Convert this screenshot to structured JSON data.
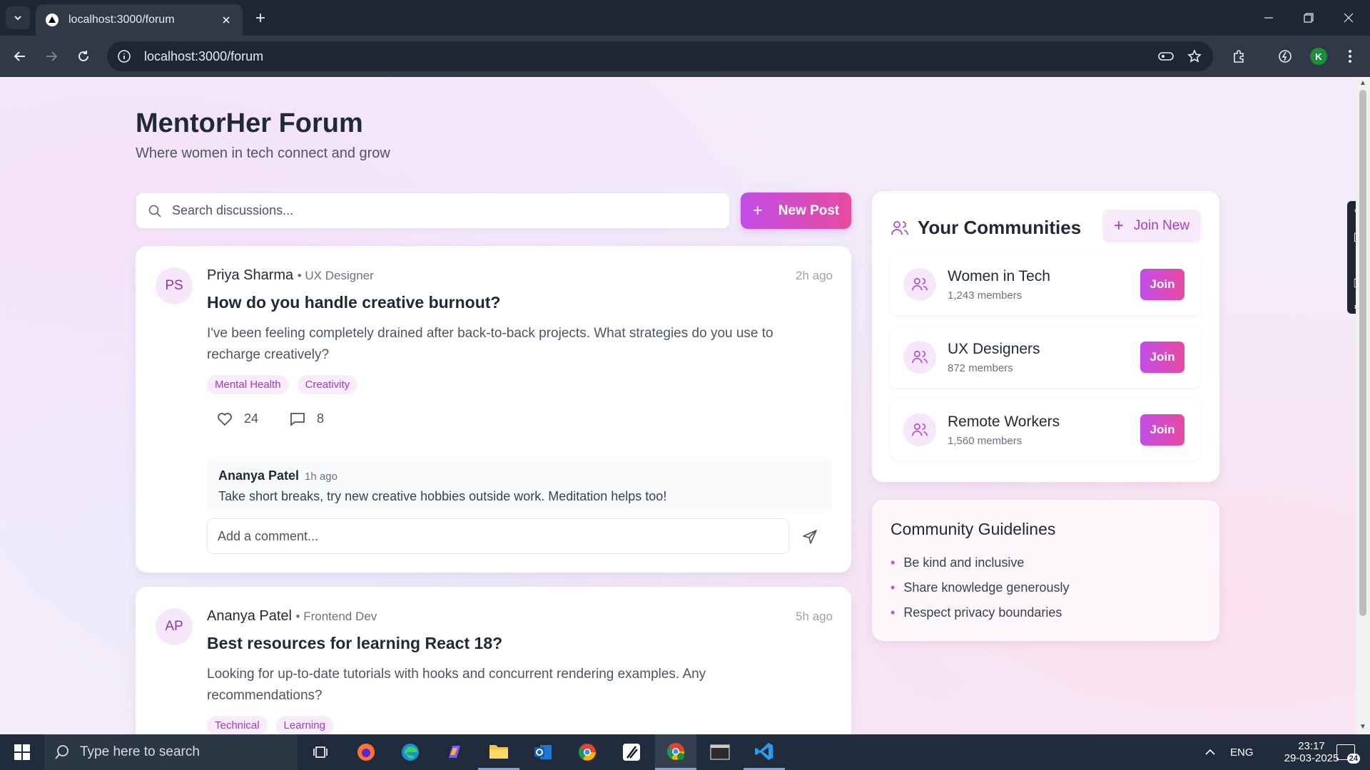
{
  "browser": {
    "tab_title": "localhost:3000/forum",
    "url": "localhost:3000/forum",
    "profile_initial": "K"
  },
  "header": {
    "title": "MentorHer Forum",
    "subtitle": "Where women in tech connect and grow"
  },
  "search": {
    "placeholder": "Search discussions..."
  },
  "new_post_label": "New Post",
  "posts": [
    {
      "initials": "PS",
      "author": "Priya Sharma",
      "role": "• UX Designer",
      "time": "2h ago",
      "title": "How do you handle creative burnout?",
      "body": "I've been feeling completely drained after back-to-back projects. What strategies do you use to recharge creatively?",
      "tags": [
        "Mental Health",
        "Creativity"
      ],
      "likes": "24",
      "comments": "8",
      "reply": {
        "author": "Ananya Patel",
        "time": "1h ago",
        "text": "Take short breaks, try new creative hobbies outside work. Meditation helps too!"
      },
      "comment_placeholder": "Add a comment..."
    },
    {
      "initials": "AP",
      "author": "Ananya Patel",
      "role": "• Frontend Dev",
      "time": "5h ago",
      "title": "Best resources for learning React 18?",
      "body": "Looking for up-to-date tutorials with hooks and concurrent rendering examples. Any recommendations?",
      "tags": [
        "Technical",
        "Learning"
      ]
    }
  ],
  "communities": {
    "title": "Your Communities",
    "join_new_label": "Join New",
    "join_label": "Join",
    "items": [
      {
        "name": "Women in Tech",
        "members": "1,243 members"
      },
      {
        "name": "UX Designers",
        "members": "872 members"
      },
      {
        "name": "Remote Workers",
        "members": "1,560 members"
      }
    ]
  },
  "guidelines": {
    "title": "Community Guidelines",
    "items": [
      "Be kind and inclusive",
      "Share knowledge generously",
      "Respect privacy boundaries"
    ]
  },
  "taskbar": {
    "search_placeholder": "Type here to search",
    "language": "ENG",
    "time": "23:17",
    "date": "29-03-2025",
    "notification_count": "24"
  },
  "colors": {
    "accent_start": "#c14ee8",
    "accent_end": "#e84ba0",
    "tag_text": "#a13dbf"
  }
}
